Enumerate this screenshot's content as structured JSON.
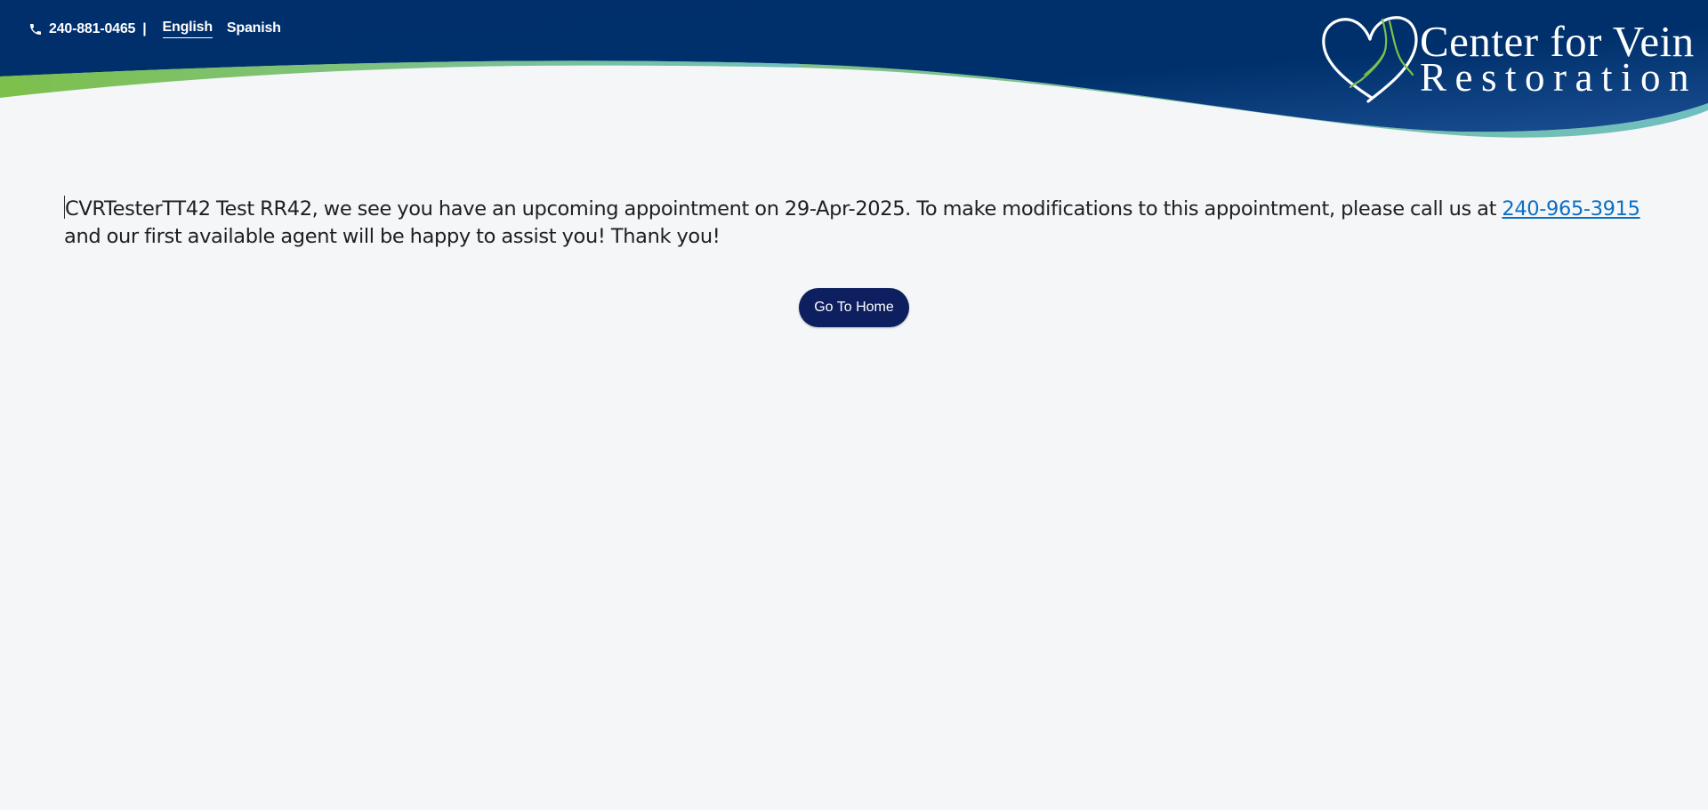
{
  "header": {
    "phone": "240-881-0465",
    "separator": "|",
    "languages": [
      {
        "label": "English",
        "active": true
      },
      {
        "label": "Spanish",
        "active": false
      }
    ],
    "logo_line1": "Center for Vein",
    "logo_line2": "Restoration"
  },
  "main": {
    "message_part1": "CVRTesterTT42 Test RR42, we see you have an upcoming appointment on 29-Apr-2025. To make modifications to this appointment, please call us at ",
    "message_phone_link": "240-965-3915",
    "message_part2": " and our first available agent will be happy to assist you! Thank you!",
    "home_button_label": "Go To Home"
  },
  "colors": {
    "header_navy": "#00306b",
    "accent_green": "#7dc04b",
    "accent_teal": "#6fbfb4",
    "button_navy": "#0e1f5f",
    "link_blue": "#0b6fc7",
    "page_background": "#f4f6f8"
  },
  "icons": {
    "phone": "phone-icon",
    "logo": "heart-leg-logo-icon"
  }
}
